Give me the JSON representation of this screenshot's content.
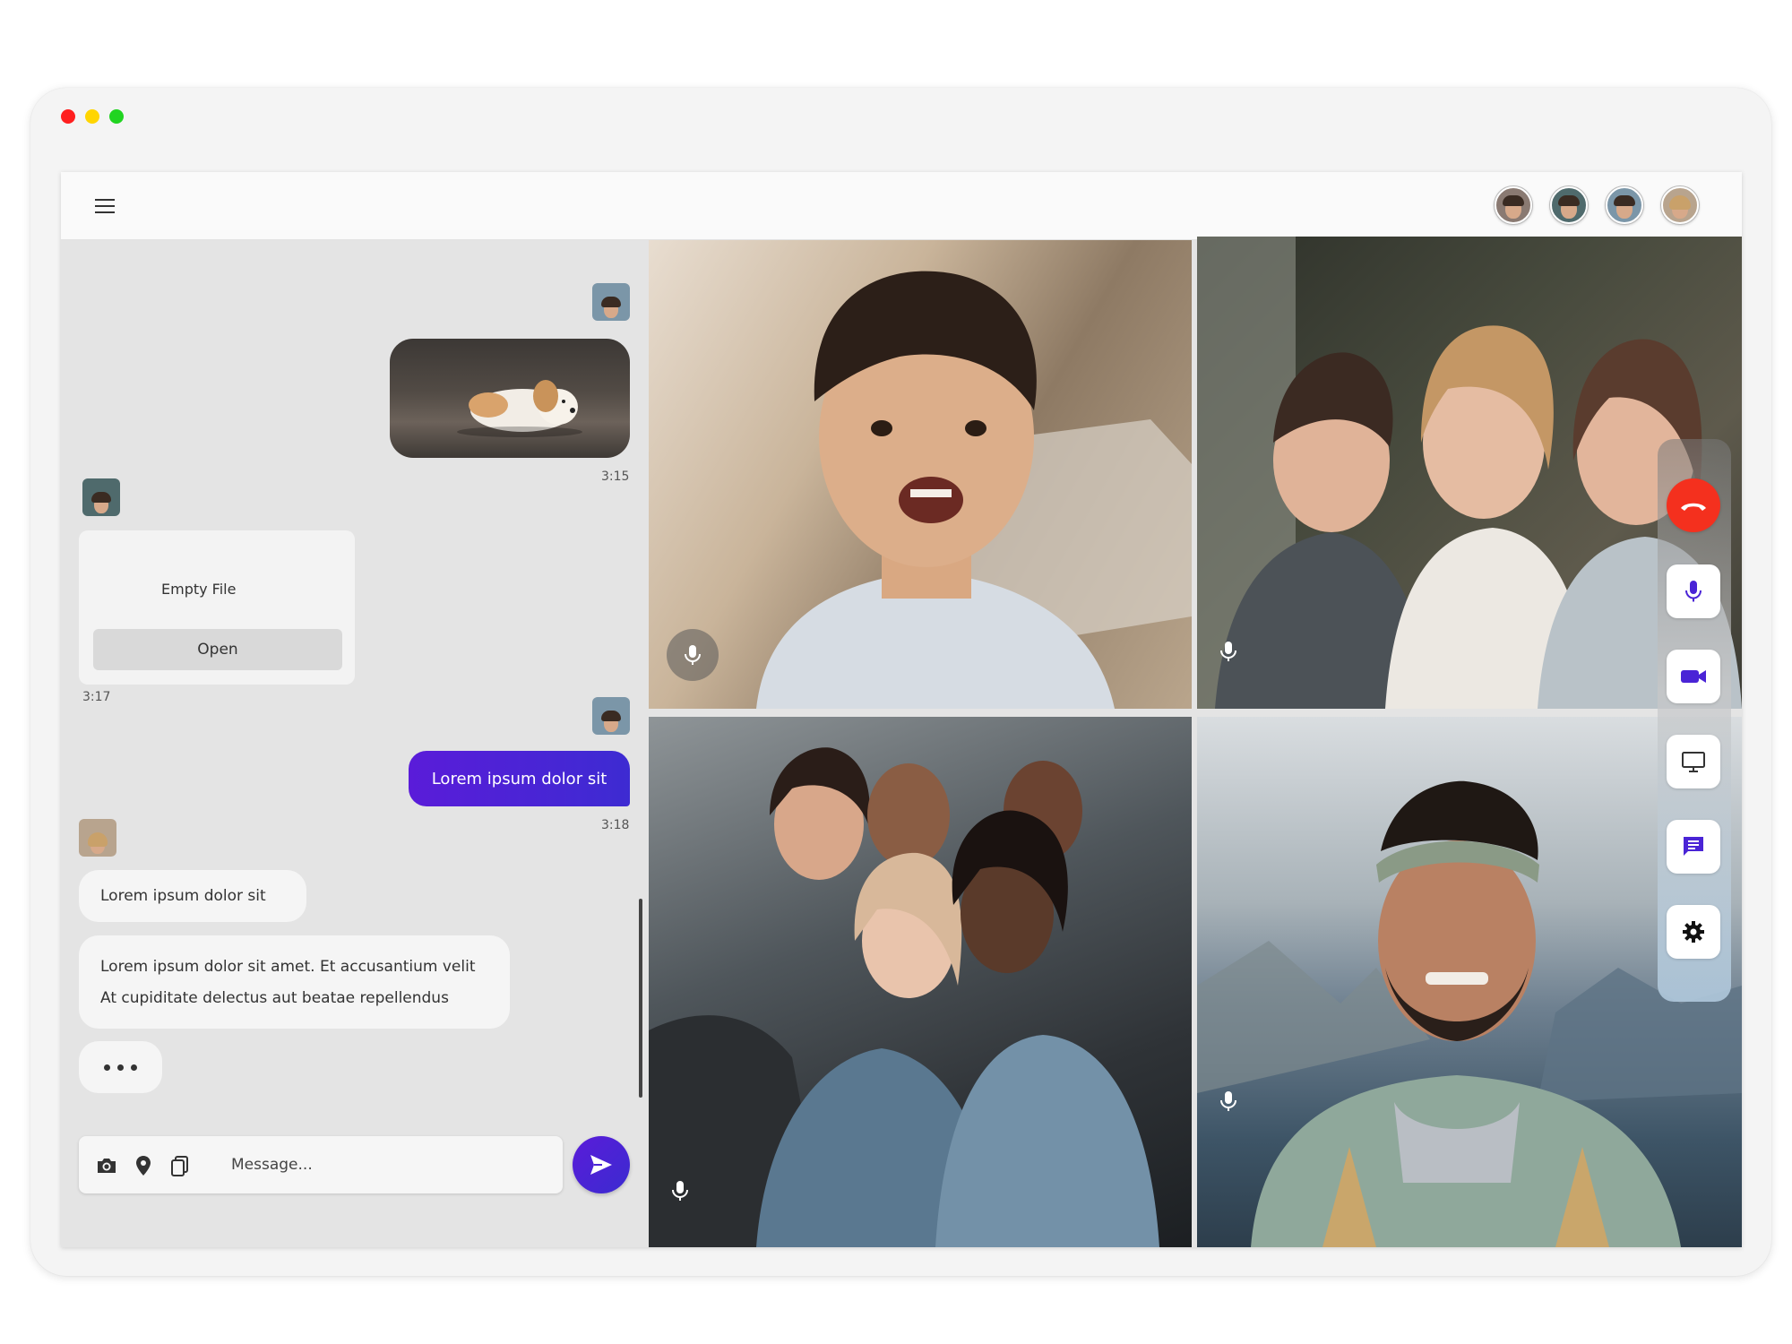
{
  "colors": {
    "accent": "#4a24d6",
    "end_call": "#f4301e",
    "traffic_red": "#ff1f1f",
    "traffic_yellow": "#ffd500",
    "traffic_green": "#21d421"
  },
  "topbar": {
    "menu_icon": "hamburger-icon",
    "participants": [
      "participant-1",
      "participant-2",
      "participant-3",
      "participant-4"
    ]
  },
  "chat": {
    "messages": [
      {
        "type": "image",
        "direction": "sent",
        "time": "3:15"
      },
      {
        "type": "file",
        "direction": "received",
        "file_name": "Empty File",
        "action": "Open",
        "time": "3:17"
      },
      {
        "type": "text",
        "direction": "sent",
        "text": "Lorem ipsum dolor sit",
        "time": "3:18"
      },
      {
        "type": "text",
        "direction": "received",
        "text": "Lorem ipsum dolor sit"
      },
      {
        "type": "text",
        "direction": "received",
        "text": "Lorem ipsum dolor sit amet. Et accusantium velit At cupiditate delectus aut beatae repellendus"
      }
    ],
    "composer": {
      "placeholder": "Message...",
      "icons": [
        "camera-icon",
        "location-pin-icon",
        "copy-icon",
        "send-icon"
      ]
    }
  },
  "video": {
    "tiles": [
      {
        "name": "tile-boy",
        "mic": "mic-icon"
      },
      {
        "name": "tile-kids",
        "mic": "mic-icon"
      },
      {
        "name": "tile-friends",
        "mic": "mic-icon"
      },
      {
        "name": "tile-man",
        "mic": "mic-icon"
      }
    ]
  },
  "controls": {
    "buttons": [
      "end-call-icon",
      "microphone-icon",
      "video-camera-icon",
      "screen-share-icon",
      "chat-icon",
      "settings-gear-icon"
    ]
  }
}
